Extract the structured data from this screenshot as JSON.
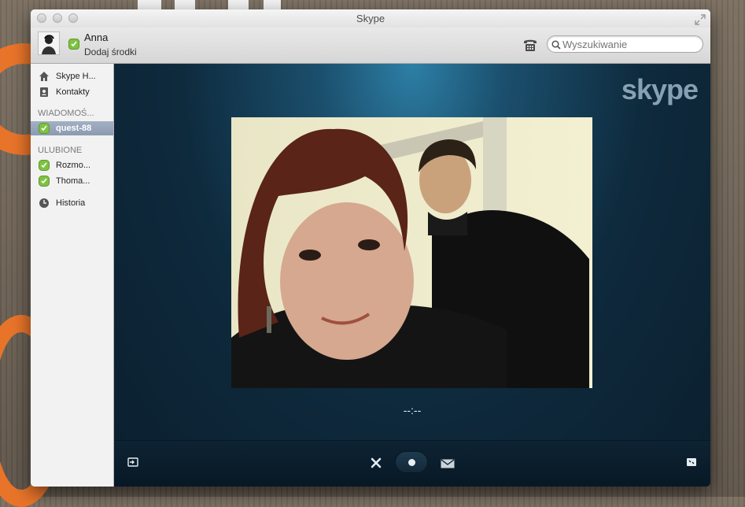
{
  "window": {
    "title": "Skype"
  },
  "profile": {
    "name": "Anna",
    "mood": "Dodaj środki",
    "status": "online"
  },
  "search": {
    "placeholder": "Wyszukiwanie"
  },
  "sidebar": {
    "nav": [
      {
        "label": "Skype H...",
        "icon": "home-icon"
      },
      {
        "label": "Kontakty",
        "icon": "contacts-icon"
      }
    ],
    "messages_header": "WIADOMOŚ...",
    "messages": [
      {
        "label": "quest-88",
        "icon": "status-online-icon",
        "selected": true
      }
    ],
    "favorites_header": "ULUBIONE",
    "favorites": [
      {
        "label": "Rozmo...",
        "icon": "status-online-icon"
      },
      {
        "label": "Thoma...",
        "icon": "status-online-icon"
      }
    ],
    "history": {
      "label": "Historia",
      "icon": "clock-icon"
    }
  },
  "call": {
    "brand": "skype",
    "timer": "--:--",
    "controls": [
      "exit-fullscreen-icon",
      "hangup-icon",
      "record-icon",
      "message-icon",
      "fullscreen-icon"
    ]
  },
  "colors": {
    "accent_status": "#7ec242",
    "selected_item": "#8c9ab1",
    "call_background": "#0e2a3d"
  }
}
